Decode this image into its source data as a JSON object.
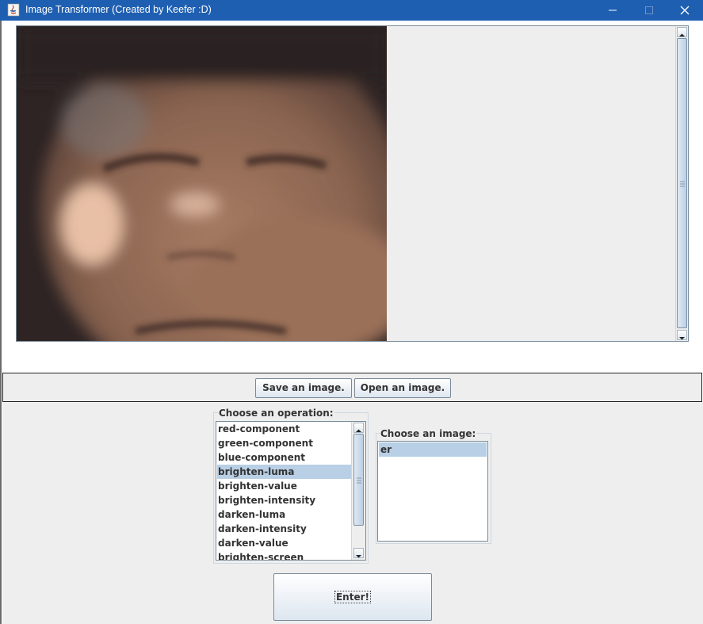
{
  "window": {
    "title": "Image Transformer (Created by Keefer :D)"
  },
  "buttons": {
    "save_label": "Save an image.",
    "open_label": "Open an image.",
    "enter_label": "Enter!"
  },
  "operations": {
    "group_title": "Choose an operation:",
    "items": [
      "red-component",
      "green-component",
      "blue-component",
      "brighten-luma",
      "brighten-value",
      "brighten-intensity",
      "darken-luma",
      "darken-intensity",
      "darken-value",
      "brighten-screen"
    ],
    "selected": "brighten-luma"
  },
  "images": {
    "group_title": "Choose an image:",
    "items": [
      "er"
    ],
    "selected": "er"
  },
  "colors": {
    "title_bar": "#1f5fb1",
    "selection": "#b8cfe5"
  }
}
